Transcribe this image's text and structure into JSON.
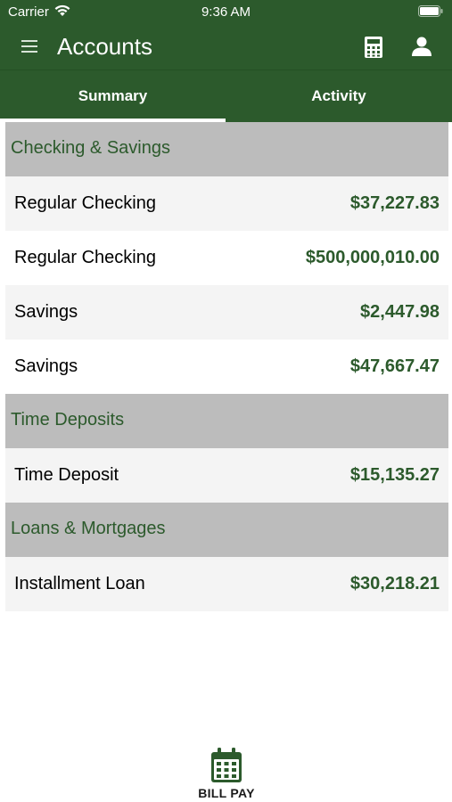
{
  "status_bar": {
    "carrier": "Carrier",
    "time": "9:36 AM"
  },
  "nav": {
    "title": "Accounts"
  },
  "tabs": [
    {
      "label": "Summary",
      "selected": true
    },
    {
      "label": "Activity",
      "selected": false
    }
  ],
  "sections": [
    {
      "title": "Checking & Savings",
      "accounts": [
        {
          "name": "Regular Checking",
          "balance": "$37,227.83"
        },
        {
          "name": "Regular Checking",
          "balance": "$500,000,010.00"
        },
        {
          "name": "Savings",
          "balance": "$2,447.98"
        },
        {
          "name": "Savings",
          "balance": "$47,667.47"
        }
      ]
    },
    {
      "title": "Time Deposits",
      "accounts": [
        {
          "name": "Time Deposit",
          "balance": "$15,135.27"
        }
      ]
    },
    {
      "title": "Loans & Mortgages",
      "accounts": [
        {
          "name": "Installment Loan",
          "balance": "$30,218.21"
        }
      ]
    }
  ],
  "bottom": {
    "bill_pay_label": "BILL PAY"
  },
  "colors": {
    "brand_green": "#2c5a2c",
    "section_gray": "#bcbcbc"
  },
  "icons": [
    "wifi-icon",
    "battery-icon",
    "menu-icon",
    "calculator-icon",
    "profile-icon",
    "calendar-icon"
  ]
}
